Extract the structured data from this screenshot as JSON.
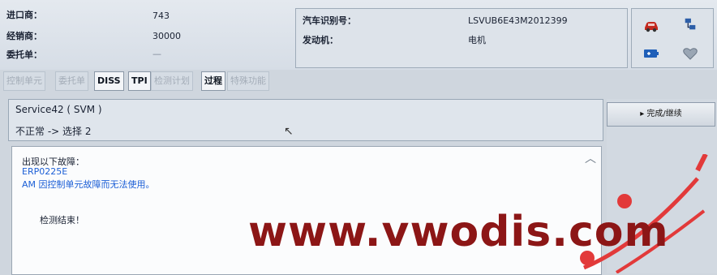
{
  "header": {
    "import_dealer_label": "进口商：",
    "import_dealer_value": "743",
    "dealer_label": "经销商：",
    "dealer_value": "30000",
    "order_label": "委托单：",
    "order_value": "—",
    "vin_label": "汽车识别号：",
    "vin_value": "LSVUB6E43M2012399",
    "engine_label": "发动机：",
    "engine_value": "电机"
  },
  "icons": [
    "car-icon",
    "network-icon",
    "battery-icon",
    "heart-icon"
  ],
  "tabs": [
    {
      "label": "控制单元",
      "active": false
    },
    {
      "label": "委托单",
      "active": false
    },
    {
      "label": "DISS",
      "active": true
    },
    {
      "label": "TPI",
      "active": true
    },
    {
      "label": "检测计划",
      "active": false
    },
    {
      "label": "过程",
      "active": true
    },
    {
      "label": "特殊功能",
      "active": false
    }
  ],
  "service": {
    "title": "Service42 ( SVM )",
    "status": "不正常 -> 选择 2"
  },
  "message": {
    "line1": "出现以下故障：",
    "line2": "ERP0225E",
    "line3": "AM 因控制单元故障而无法使用。",
    "line4": "检测结束！"
  },
  "right": {
    "finish_button": "▸ 完成/继续"
  },
  "watermark": "www.vwodis.com",
  "colors": {
    "accent_blue": "#1c5fd6",
    "watermark_red": "#8c1616"
  }
}
